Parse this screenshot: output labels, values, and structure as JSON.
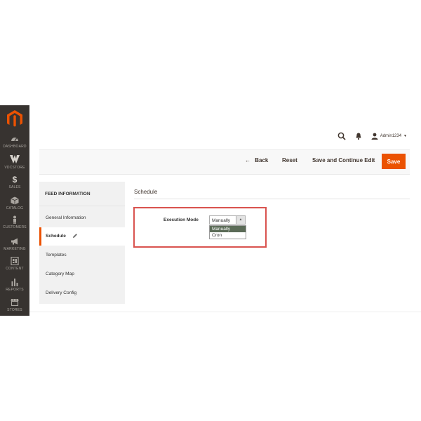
{
  "sidebar": {
    "items": [
      {
        "label": "Dashboard",
        "icon": "dashboard-icon"
      },
      {
        "label": "VDCStore",
        "icon": "vdcstore-icon"
      },
      {
        "label": "Sales",
        "icon": "dollar-icon"
      },
      {
        "label": "Catalog",
        "icon": "cube-icon"
      },
      {
        "label": "Customers",
        "icon": "person-icon"
      },
      {
        "label": "Marketing",
        "icon": "megaphone-icon"
      },
      {
        "label": "Content",
        "icon": "layout-icon"
      },
      {
        "label": "Reports",
        "icon": "bar-chart-icon"
      },
      {
        "label": "Stores",
        "icon": "store-icon"
      }
    ]
  },
  "header": {
    "user_name": "Admin1234",
    "colors": {
      "accent": "#eb5202",
      "sidebar": "#373330"
    }
  },
  "actions": {
    "back": "Back",
    "reset": "Reset",
    "save_continue": "Save and Continue Edit",
    "save": "Save"
  },
  "tabs": {
    "title": "FEED INFORMATION",
    "items": [
      {
        "label": "General Information"
      },
      {
        "label": "Schedule"
      },
      {
        "label": "Templates"
      },
      {
        "label": "Category Map"
      },
      {
        "label": "Delivery Config"
      }
    ]
  },
  "main": {
    "section_title": "Schedule",
    "field_label": "Execution Mode",
    "select_value": "Manually",
    "options": [
      "Manually",
      "Cron"
    ]
  }
}
